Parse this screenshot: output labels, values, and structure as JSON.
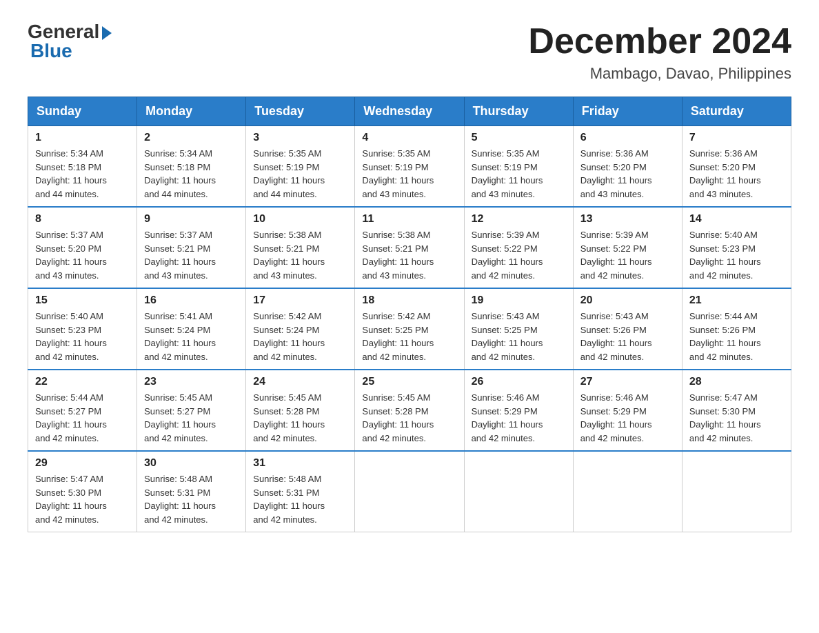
{
  "header": {
    "logo_general": "General",
    "logo_blue": "Blue",
    "month_title": "December 2024",
    "location": "Mambago, Davao, Philippines"
  },
  "days_of_week": [
    "Sunday",
    "Monday",
    "Tuesday",
    "Wednesday",
    "Thursday",
    "Friday",
    "Saturday"
  ],
  "weeks": [
    [
      {
        "day": "1",
        "sunrise": "5:34 AM",
        "sunset": "5:18 PM",
        "daylight": "11 hours and 44 minutes."
      },
      {
        "day": "2",
        "sunrise": "5:34 AM",
        "sunset": "5:18 PM",
        "daylight": "11 hours and 44 minutes."
      },
      {
        "day": "3",
        "sunrise": "5:35 AM",
        "sunset": "5:19 PM",
        "daylight": "11 hours and 44 minutes."
      },
      {
        "day": "4",
        "sunrise": "5:35 AM",
        "sunset": "5:19 PM",
        "daylight": "11 hours and 43 minutes."
      },
      {
        "day": "5",
        "sunrise": "5:35 AM",
        "sunset": "5:19 PM",
        "daylight": "11 hours and 43 minutes."
      },
      {
        "day": "6",
        "sunrise": "5:36 AM",
        "sunset": "5:20 PM",
        "daylight": "11 hours and 43 minutes."
      },
      {
        "day": "7",
        "sunrise": "5:36 AM",
        "sunset": "5:20 PM",
        "daylight": "11 hours and 43 minutes."
      }
    ],
    [
      {
        "day": "8",
        "sunrise": "5:37 AM",
        "sunset": "5:20 PM",
        "daylight": "11 hours and 43 minutes."
      },
      {
        "day": "9",
        "sunrise": "5:37 AM",
        "sunset": "5:21 PM",
        "daylight": "11 hours and 43 minutes."
      },
      {
        "day": "10",
        "sunrise": "5:38 AM",
        "sunset": "5:21 PM",
        "daylight": "11 hours and 43 minutes."
      },
      {
        "day": "11",
        "sunrise": "5:38 AM",
        "sunset": "5:21 PM",
        "daylight": "11 hours and 43 minutes."
      },
      {
        "day": "12",
        "sunrise": "5:39 AM",
        "sunset": "5:22 PM",
        "daylight": "11 hours and 42 minutes."
      },
      {
        "day": "13",
        "sunrise": "5:39 AM",
        "sunset": "5:22 PM",
        "daylight": "11 hours and 42 minutes."
      },
      {
        "day": "14",
        "sunrise": "5:40 AM",
        "sunset": "5:23 PM",
        "daylight": "11 hours and 42 minutes."
      }
    ],
    [
      {
        "day": "15",
        "sunrise": "5:40 AM",
        "sunset": "5:23 PM",
        "daylight": "11 hours and 42 minutes."
      },
      {
        "day": "16",
        "sunrise": "5:41 AM",
        "sunset": "5:24 PM",
        "daylight": "11 hours and 42 minutes."
      },
      {
        "day": "17",
        "sunrise": "5:42 AM",
        "sunset": "5:24 PM",
        "daylight": "11 hours and 42 minutes."
      },
      {
        "day": "18",
        "sunrise": "5:42 AM",
        "sunset": "5:25 PM",
        "daylight": "11 hours and 42 minutes."
      },
      {
        "day": "19",
        "sunrise": "5:43 AM",
        "sunset": "5:25 PM",
        "daylight": "11 hours and 42 minutes."
      },
      {
        "day": "20",
        "sunrise": "5:43 AM",
        "sunset": "5:26 PM",
        "daylight": "11 hours and 42 minutes."
      },
      {
        "day": "21",
        "sunrise": "5:44 AM",
        "sunset": "5:26 PM",
        "daylight": "11 hours and 42 minutes."
      }
    ],
    [
      {
        "day": "22",
        "sunrise": "5:44 AM",
        "sunset": "5:27 PM",
        "daylight": "11 hours and 42 minutes."
      },
      {
        "day": "23",
        "sunrise": "5:45 AM",
        "sunset": "5:27 PM",
        "daylight": "11 hours and 42 minutes."
      },
      {
        "day": "24",
        "sunrise": "5:45 AM",
        "sunset": "5:28 PM",
        "daylight": "11 hours and 42 minutes."
      },
      {
        "day": "25",
        "sunrise": "5:45 AM",
        "sunset": "5:28 PM",
        "daylight": "11 hours and 42 minutes."
      },
      {
        "day": "26",
        "sunrise": "5:46 AM",
        "sunset": "5:29 PM",
        "daylight": "11 hours and 42 minutes."
      },
      {
        "day": "27",
        "sunrise": "5:46 AM",
        "sunset": "5:29 PM",
        "daylight": "11 hours and 42 minutes."
      },
      {
        "day": "28",
        "sunrise": "5:47 AM",
        "sunset": "5:30 PM",
        "daylight": "11 hours and 42 minutes."
      }
    ],
    [
      {
        "day": "29",
        "sunrise": "5:47 AM",
        "sunset": "5:30 PM",
        "daylight": "11 hours and 42 minutes."
      },
      {
        "day": "30",
        "sunrise": "5:48 AM",
        "sunset": "5:31 PM",
        "daylight": "11 hours and 42 minutes."
      },
      {
        "day": "31",
        "sunrise": "5:48 AM",
        "sunset": "5:31 PM",
        "daylight": "11 hours and 42 minutes."
      },
      null,
      null,
      null,
      null
    ]
  ],
  "labels": {
    "sunrise": "Sunrise:",
    "sunset": "Sunset:",
    "daylight": "Daylight:"
  }
}
